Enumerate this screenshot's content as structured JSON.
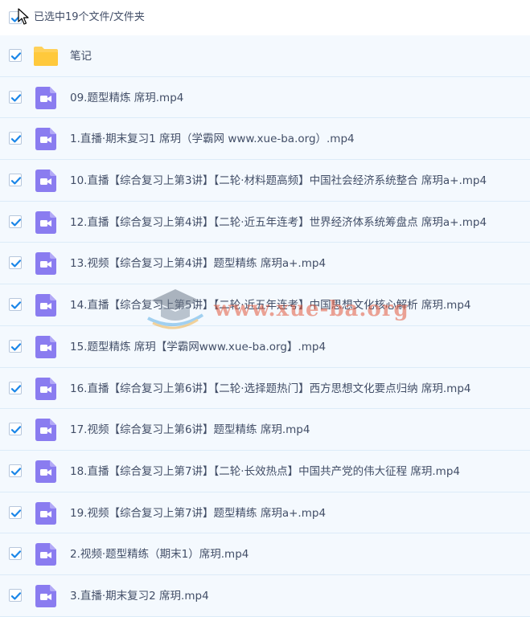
{
  "header": {
    "selection_label": "已选中19个文件/文件夹"
  },
  "watermark": {
    "text": "www.xue-ba.org"
  },
  "colors": {
    "check": "#1a86e8",
    "video_icon": "#8a7cf0",
    "folder": "#ffd15a",
    "row_bg": "#f4f9fe",
    "row_border": "#dcebf8"
  },
  "files": [
    {
      "name": "笔记",
      "icon": "folder-icon",
      "checked": true
    },
    {
      "name": "09.题型精炼 席玥.mp4",
      "icon": "video-file-icon",
      "checked": true
    },
    {
      "name": "1.直播·期末复习1 席玥（学霸网 www.xue-ba.org）.mp4",
      "icon": "video-file-icon",
      "checked": true
    },
    {
      "name": "10.直播【综合复习上第3讲】【二轮·材料题高频】中国社会经济系统整合 席玥a+.mp4",
      "icon": "video-file-icon",
      "checked": true
    },
    {
      "name": "12.直播【综合复习上第4讲】【二轮·近五年连考】世界经济体系统筹盘点 席玥a+.mp4",
      "icon": "video-file-icon",
      "checked": true
    },
    {
      "name": "13.视频【综合复习上第4讲】题型精练 席玥a+.mp4",
      "icon": "video-file-icon",
      "checked": true
    },
    {
      "name": "14.直播【综合复习上第5讲】【二轮·近五年连考】中国思想文化核心解析 席玥.mp4",
      "icon": "video-file-icon",
      "checked": true
    },
    {
      "name": "15.题型精炼 席玥【学霸网www.xue-ba.org】.mp4",
      "icon": "video-file-icon",
      "checked": true
    },
    {
      "name": "16.直播【综合复习上第6讲】【二轮·选择题热门】西方思想文化要点归纳 席玥.mp4",
      "icon": "video-file-icon",
      "checked": true
    },
    {
      "name": "17.视频【综合复习上第6讲】题型精练 席玥.mp4",
      "icon": "video-file-icon",
      "checked": true
    },
    {
      "name": "18.直播【综合复习上第7讲】【二轮·长效热点】中国共产党的伟大征程 席玥.mp4",
      "icon": "video-file-icon",
      "checked": true
    },
    {
      "name": "19.视频【综合复习上第7讲】题型精练 席玥a+.mp4",
      "icon": "video-file-icon",
      "checked": true
    },
    {
      "name": "2.视频·题型精练（期末1）席玥.mp4",
      "icon": "video-file-icon",
      "checked": true
    },
    {
      "name": "3.直播·期末复习2 席玥.mp4",
      "icon": "video-file-icon",
      "checked": true
    }
  ]
}
